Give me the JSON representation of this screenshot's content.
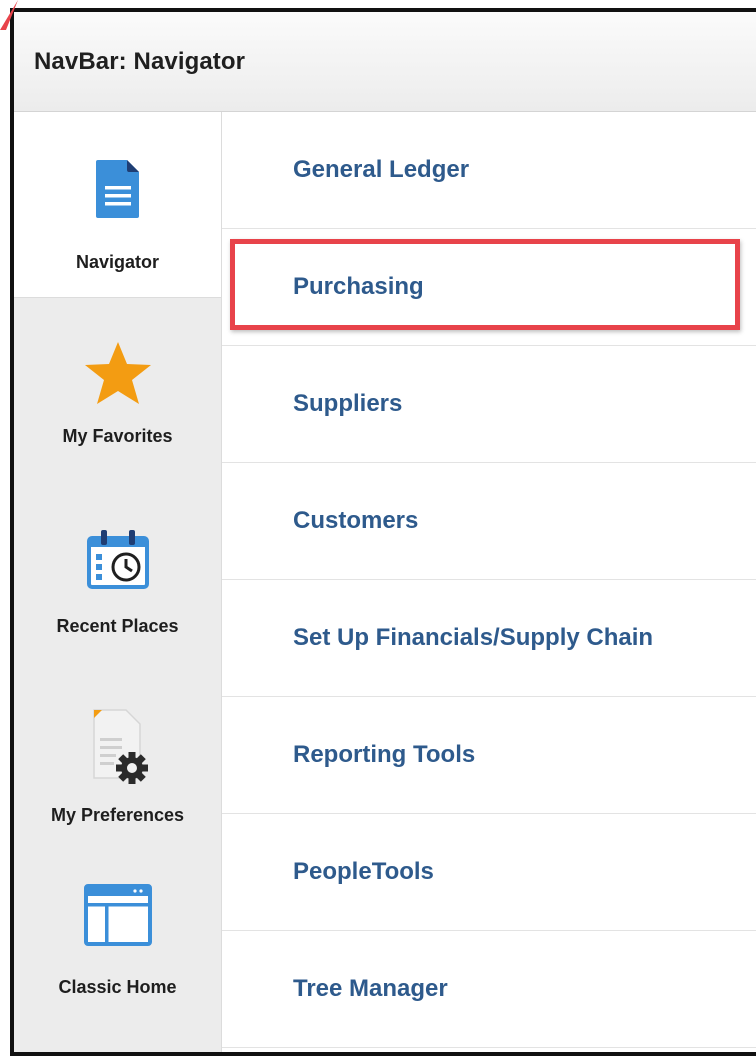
{
  "window": {
    "title": "NavBar: Navigator"
  },
  "sidebar": {
    "items": [
      {
        "label": "Navigator",
        "icon": "document-icon",
        "active": true
      },
      {
        "label": "My Favorites",
        "icon": "star-icon",
        "active": false
      },
      {
        "label": "Recent Places",
        "icon": "calendar-clock-icon",
        "active": false
      },
      {
        "label": "My Preferences",
        "icon": "document-gear-icon",
        "active": false
      },
      {
        "label": "Classic Home",
        "icon": "classic-home-icon",
        "active": false
      }
    ]
  },
  "menu": {
    "items": [
      {
        "label": "General Ledger"
      },
      {
        "label": "Purchasing",
        "highlighted": true
      },
      {
        "label": "Suppliers"
      },
      {
        "label": "Customers"
      },
      {
        "label": "Set Up Financials/Supply Chain"
      },
      {
        "label": "Reporting Tools"
      },
      {
        "label": "PeopleTools"
      },
      {
        "label": "Tree Manager"
      }
    ]
  },
  "colors": {
    "menu_link": "#2e5a8c",
    "highlight_border": "#e8434a",
    "icon_blue": "#3b8fd9",
    "icon_orange": "#f39c12"
  }
}
